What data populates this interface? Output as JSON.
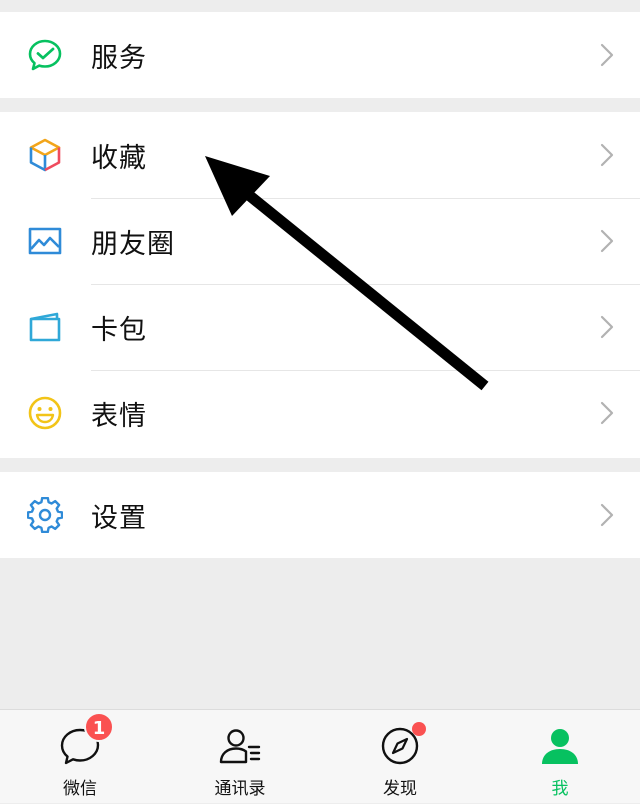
{
  "menu": {
    "services": {
      "label": "服务",
      "icon": "services-icon"
    },
    "favorites": {
      "label": "收藏",
      "icon": "favorites-cube-icon"
    },
    "moments": {
      "label": "朋友圈",
      "icon": "moments-image-icon"
    },
    "cards": {
      "label": "卡包",
      "icon": "card-wallet-icon"
    },
    "stickers": {
      "label": "表情",
      "icon": "smiley-icon"
    },
    "settings": {
      "label": "设置",
      "icon": "gear-icon"
    }
  },
  "tabbar": {
    "chats": {
      "label": "微信",
      "badge": "1",
      "icon": "chat-bubble-icon"
    },
    "contacts": {
      "label": "通讯录",
      "icon": "contacts-icon"
    },
    "discover": {
      "label": "发现",
      "icon": "compass-icon",
      "has_dot": true
    },
    "me": {
      "label": "我",
      "icon": "person-icon",
      "active": true
    }
  },
  "colors": {
    "accent": "#07c160",
    "badge": "#fa5151",
    "background": "#ededed"
  }
}
